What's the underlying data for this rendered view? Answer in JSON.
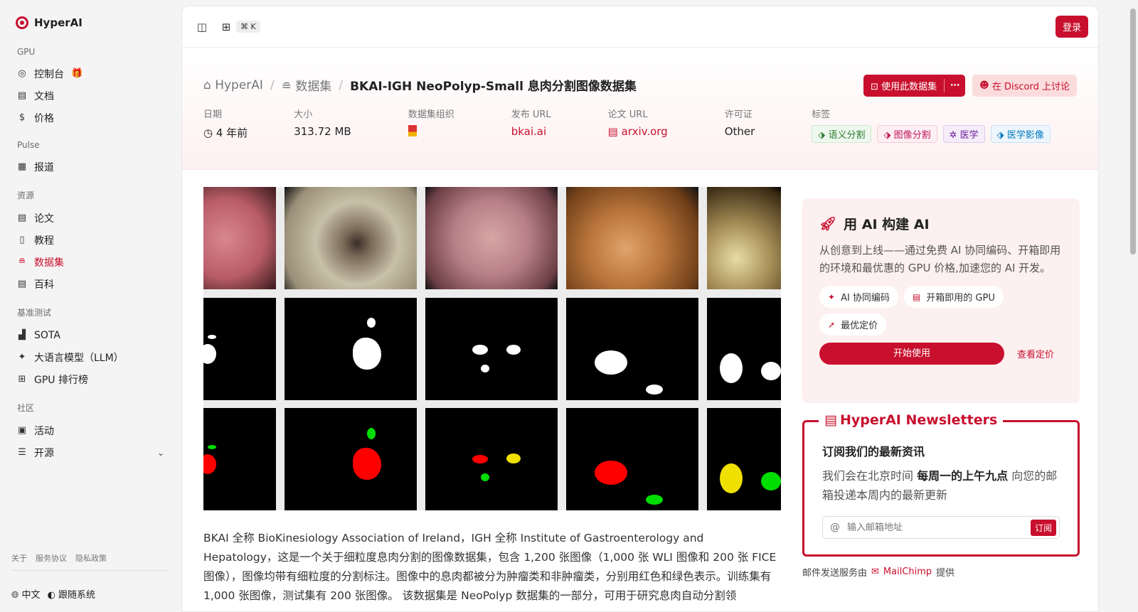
{
  "brand": {
    "name": "HyperAI"
  },
  "sidebar": {
    "groups": [
      {
        "title": "GPU",
        "items": [
          {
            "label": "控制台",
            "icon": "dashboard-icon"
          },
          {
            "label": "文档",
            "icon": "doc-icon"
          },
          {
            "label": "价格",
            "icon": "price-icon"
          }
        ]
      },
      {
        "title": "Pulse",
        "items": [
          {
            "label": "报道",
            "icon": "news-icon"
          }
        ]
      },
      {
        "title": "资源",
        "items": [
          {
            "label": "论文",
            "icon": "paper-icon"
          },
          {
            "label": "教程",
            "icon": "book-icon"
          },
          {
            "label": "数据集",
            "icon": "database-icon"
          },
          {
            "label": "百科",
            "icon": "wiki-icon"
          }
        ]
      },
      {
        "title": "基准测试",
        "items": [
          {
            "label": "SOTA",
            "icon": "chart-icon"
          },
          {
            "label": "大语言模型（LLM）",
            "icon": "sparkle-icon"
          },
          {
            "label": "GPU 排行榜",
            "icon": "cpu-icon"
          }
        ]
      },
      {
        "title": "社区",
        "items": [
          {
            "label": "活动",
            "icon": "calendar-icon"
          },
          {
            "label": "开源",
            "icon": "list-icon"
          }
        ]
      }
    ],
    "footer_links": [
      "关于",
      "服务协议",
      "隐私政策"
    ],
    "lang": "中文",
    "theme": "跟随系统"
  },
  "topbar": {
    "shortcut": "⌘ K",
    "login": "登录"
  },
  "header": {
    "breadcrumb": [
      "HyperAI",
      "数据集"
    ],
    "title": "BKAI-IGH NeoPolyp-Small 息肉分割图像数据集",
    "use_dataset": "使用此数据集",
    "more": "⋯",
    "discord": "在 Discord 上讨论",
    "meta": {
      "date_label": "日期",
      "date_value": "4 年前",
      "size_label": "大小",
      "size_value": "313.72 MB",
      "org_label": "数据集组织",
      "url_label": "发布 URL",
      "url_value": "bkai.ai",
      "paper_label": "论文 URL",
      "paper_value": "arxiv.org",
      "license_label": "许可证",
      "license_value": "Other",
      "tags_label": "标签"
    },
    "tags": [
      "语义分割",
      "图像分割",
      "医学",
      "医学影像"
    ]
  },
  "description": "BKAI 全称 BioKinesiology Association of Ireland，IGH 全称 Institute of Gastroenterology and Hepatology，这是一个关于细粒度息肉分割的图像数据集，包含 1,200 张图像（1,000 张 WLI 图像和 200 张 FICE 图像），图像均带有细粒度的分割标注。图像中的息肉都被分为肿瘤类和非肿瘤类，分别用红色和绿色表示。训练集有 1,000 张图像，测试集有 200 张图像。 该数据集是 NeoPolyp 数据集的一部分，可用于研究息肉自动分割领",
  "promo": {
    "title": "用 AI 构建 AI",
    "text": "从创意到上线——通过免费 AI 协同编码、开箱即用的环境和最优惠的 GPU 价格,加速您的 AI 开发。",
    "chips": [
      "AI 协同编码",
      "开箱即用的 GPU",
      "最优定价"
    ],
    "start": "开始使用",
    "pricing": "查看定价"
  },
  "newsletter": {
    "title": "HyperAI Newsletters",
    "subtitle": "订阅我们的最新资讯",
    "text_before": "我们会在北京时间 ",
    "text_bold": "每周一的上午九点",
    "text_after": " 向您的邮箱投递本周内的最新更新",
    "placeholder": "输入邮箱地址",
    "subscribe": "订阅",
    "note_before": "邮件发送服务由",
    "note_brand": "MailChimp",
    "note_after": "提供"
  },
  "colors": {
    "accent": "#c8102e",
    "neoplastic": "#ff0000",
    "non_neoplastic": "#00dd00"
  }
}
